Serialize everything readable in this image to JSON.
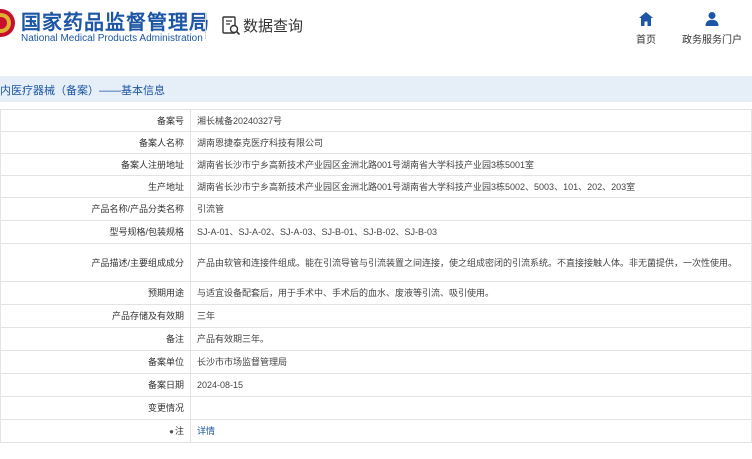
{
  "header": {
    "brand_cn": "国家药品监督管理局",
    "brand_en": "National Medical Products Administration",
    "query_title": "数据查询",
    "query_icon": "document-search-icon",
    "nav": [
      {
        "label": "首页",
        "icon": "home-icon"
      },
      {
        "label": "政务服务门户",
        "icon": "user-icon"
      }
    ],
    "colors": {
      "brand": "#1c56a4",
      "section_bg": "#e6eef7"
    }
  },
  "section": {
    "title": "内医疗器械（备案）——基本信息"
  },
  "rows": [
    {
      "label": "备案号",
      "value": "湘长械备20240327号"
    },
    {
      "label": "备案人名称",
      "value": "湖南恩捷泰克医疗科技有限公司"
    },
    {
      "label": "备案人注册地址",
      "value": "湖南省长沙市宁乡高新技术产业园区金洲北路001号湖南省大学科技产业园3栋5001室"
    },
    {
      "label": "生产地址",
      "value": "湖南省长沙市宁乡高新技术产业园区金洲北路001号湖南省大学科技产业园3栋5002、5003、101、202、203室"
    },
    {
      "label": "产品名称/产品分类名称",
      "value": "引流管"
    },
    {
      "label": "型号规格/包装规格",
      "value": "SJ-A-01、SJ-A-02、SJ-A-03、SJ-B-01、SJ-B-02、SJ-B-03"
    },
    {
      "label": "产品描述/主要组成成分",
      "value": "产品由软管和连接件组成。能在引流导管与引流装置之间连接，使之组成密闭的引流系统。不直接接触人体。非无菌提供，一次性使用。"
    },
    {
      "label": "预期用途",
      "value": "与适宜设备配套后，用于手术中、手术后的血水、废液等引流、吸引使用。"
    },
    {
      "label": "产品存储及有效期",
      "value": "三年"
    },
    {
      "label": "备注",
      "value": "产品有效期三年。"
    },
    {
      "label": "备案单位",
      "value": "长沙市市场监督管理局"
    },
    {
      "label": "备案日期",
      "value": "2024-08-15"
    },
    {
      "label": "变更情况",
      "value": ""
    },
    {
      "label": "注",
      "label_icon": "bullet-icon",
      "label_icon_glyph": "●",
      "value": "详情"
    }
  ]
}
